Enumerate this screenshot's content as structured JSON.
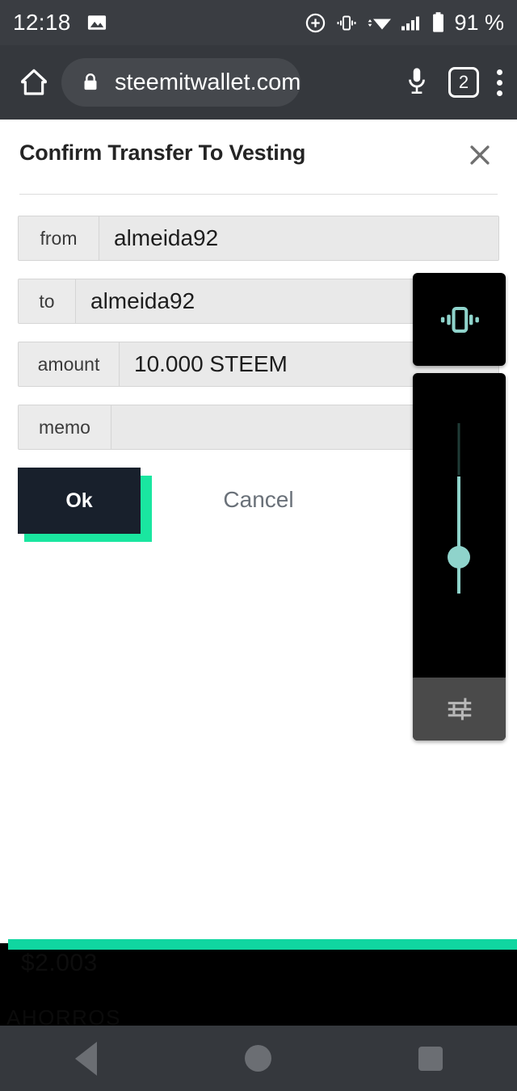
{
  "status_bar": {
    "clock": "12:18",
    "battery_percent": "91 %",
    "icons": {
      "gallery": "image-icon",
      "alarm": "alarm-plus-icon",
      "vibrate": "vibrate-icon",
      "wifi": "wifi-icon",
      "signal": "cell-signal-icon",
      "battery": "battery-icon"
    }
  },
  "browser": {
    "home_icon": "home-icon",
    "lock_icon": "lock-icon",
    "url": "steemitwallet.com",
    "mic_icon": "microphone-icon",
    "tab_count": "2",
    "menu_icon": "overflow-menu-icon"
  },
  "dialog": {
    "title": "Confirm Transfer To Vesting",
    "close_icon": "close-icon",
    "fields": [
      {
        "label": "from",
        "value": "almeida92"
      },
      {
        "label": "to",
        "value": "almeida92"
      },
      {
        "label": "amount",
        "value": "10.000 STEEM"
      },
      {
        "label": "memo",
        "value": ""
      }
    ],
    "ok_label": "Ok",
    "cancel_label": "Cancel"
  },
  "background_page": {
    "amount_text": "$2.003",
    "section_label": "AHORROS"
  },
  "volume_panel": {
    "ring_mode_icon": "vibrate-icon",
    "slider_thumb_icon": "volume-slider-thumb",
    "media_icon": "music-note-icon",
    "settings_icon": "sound-settings-sliders-icon"
  },
  "nav_bar": {
    "back_icon": "back-triangle-icon",
    "home_icon": "home-circle-icon",
    "recents_icon": "recents-square-icon"
  },
  "colors": {
    "accent_teal": "#10d6a0",
    "panel_teal": "#8fd3cb",
    "toolbar_dark": "#35383d",
    "status_dark": "#3a3d42",
    "button_dark": "#18202c"
  }
}
